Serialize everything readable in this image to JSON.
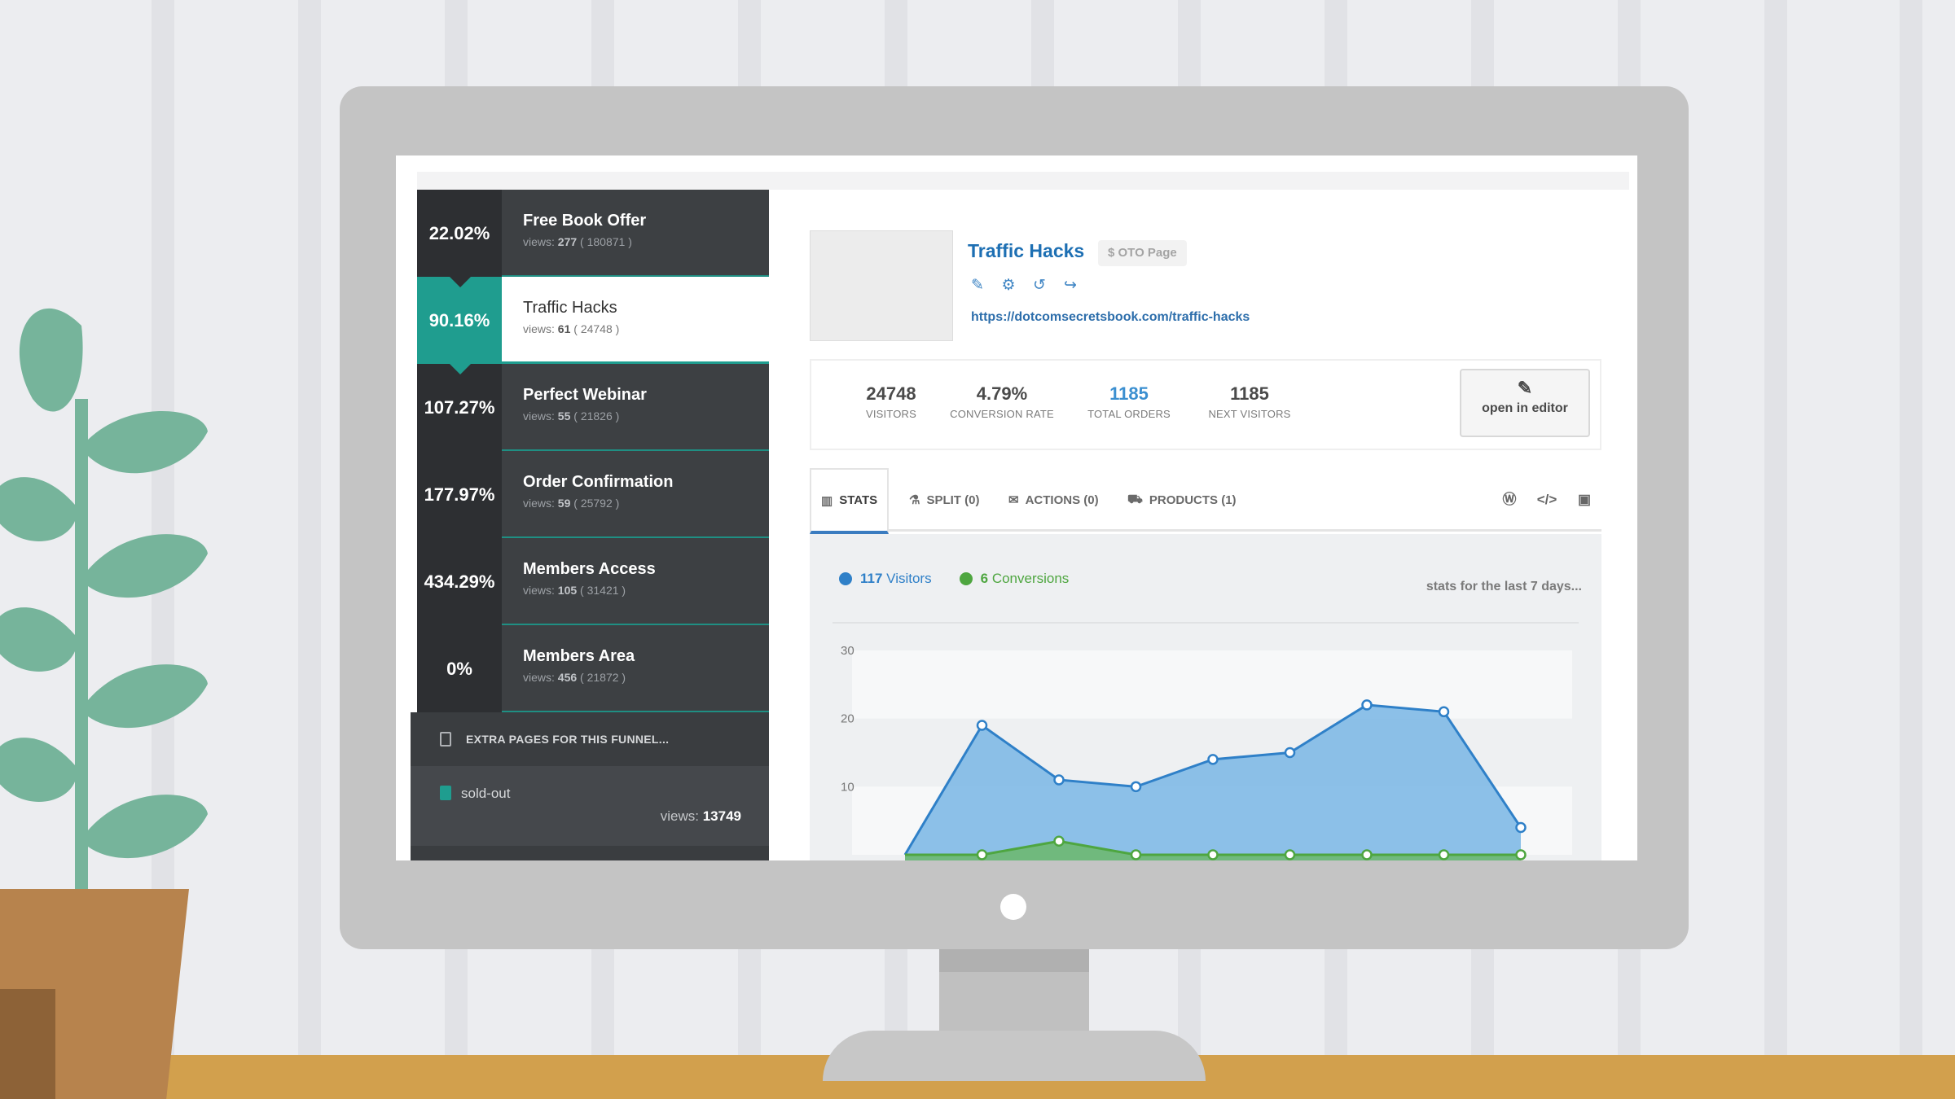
{
  "funnel": {
    "steps": [
      {
        "pct": "22.02%",
        "name": "Free Book Offer",
        "views_label": "views:",
        "views": "277",
        "views_total": "( 180871 )",
        "active": false
      },
      {
        "pct": "90.16%",
        "name": "Traffic Hacks",
        "views_label": "views:",
        "views": "61",
        "views_total": "( 24748 )",
        "active": true
      },
      {
        "pct": "107.27%",
        "name": "Perfect Webinar",
        "views_label": "views:",
        "views": "55",
        "views_total": "( 21826 )",
        "active": false
      },
      {
        "pct": "177.97%",
        "name": "Order Confirmation",
        "views_label": "views:",
        "views": "59",
        "views_total": "( 25792 )",
        "active": false
      },
      {
        "pct": "434.29%",
        "name": "Members Access",
        "views_label": "views:",
        "views": "105",
        "views_total": "( 31421 )",
        "active": false
      },
      {
        "pct": "0%",
        "name": "Members Area",
        "views_label": "views:",
        "views": "456",
        "views_total": "( 21872 )",
        "active": false
      }
    ],
    "extra_header": "EXTRA PAGES FOR THIS FUNNEL...",
    "extra_item": {
      "name": "sold-out",
      "views_label": "views:",
      "views": "13749"
    }
  },
  "page": {
    "title": "Traffic Hacks",
    "badge": "$ OTO Page",
    "url": "https://dotcomsecretsbook.com/traffic-hacks",
    "icons": [
      "edit-icon",
      "gear-icon",
      "undo-icon",
      "share-icon"
    ]
  },
  "stats": [
    {
      "value": "24748",
      "label": "VISITORS",
      "highlight": false
    },
    {
      "value": "4.79%",
      "label": "CONVERSION RATE",
      "highlight": false
    },
    {
      "value": "1185",
      "label": "TOTAL ORDERS",
      "highlight": true
    },
    {
      "value": "1185",
      "label": "NEXT VISITORS",
      "highlight": false
    }
  ],
  "open_editor": "open in editor",
  "tabs": [
    {
      "label": "STATS",
      "icon": "bar-chart-icon",
      "active": true
    },
    {
      "label": "SPLIT (0)",
      "icon": "flask-icon",
      "active": false
    },
    {
      "label": "ACTIONS (0)",
      "icon": "envelope-icon",
      "active": false
    },
    {
      "label": "PRODUCTS (1)",
      "icon": "cart-icon",
      "active": false
    }
  ],
  "tab_icons_right": [
    "wordpress-icon",
    "code-icon",
    "facebook-icon"
  ],
  "legend": {
    "visitors_count": "117",
    "visitors_label": "Visitors",
    "conversions_count": "6",
    "conversions_label": "Conversions"
  },
  "stats_note": "stats for the last 7 days...",
  "colors": {
    "visitors": "#2f80c8",
    "visitors_fill": "#7fb9e6",
    "conversions": "#4ea640",
    "conversions_fill": "#6bb76a",
    "accent_teal": "#1f9d8f"
  },
  "chart_data": {
    "type": "area",
    "yticks": [
      30,
      20,
      10
    ],
    "ylim": [
      0,
      30
    ],
    "grid": true,
    "series": [
      {
        "name": "Visitors",
        "values": [
          0,
          19,
          11,
          10,
          14,
          15,
          22,
          21,
          4
        ]
      },
      {
        "name": "Conversions",
        "values": [
          0,
          0,
          2,
          0,
          0,
          0,
          0,
          0,
          0
        ]
      }
    ]
  }
}
